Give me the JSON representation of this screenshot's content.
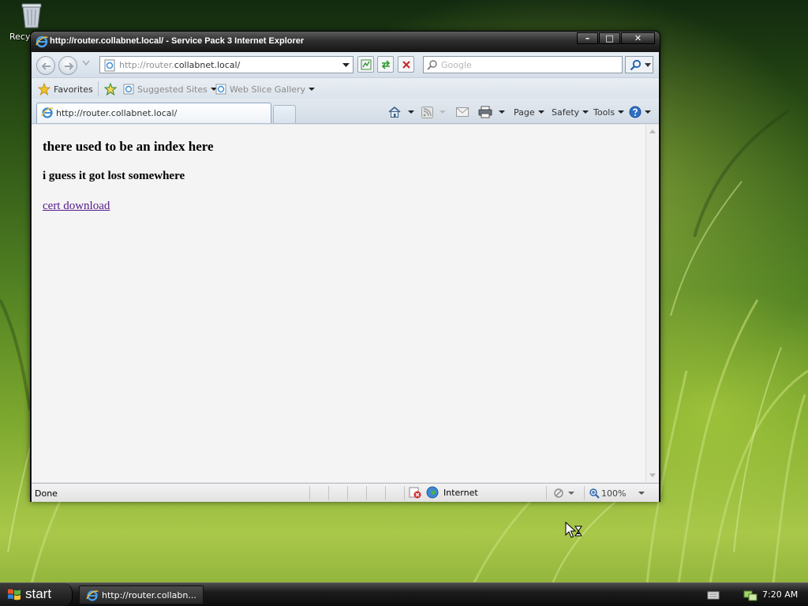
{
  "desktop": {
    "recycle_bin_label": "Recycle Bin"
  },
  "window": {
    "title": "http://router.collabnet.local/ - Service Pack 3 Internet Explorer",
    "controls": {
      "minimize": "–",
      "maximize": "□",
      "close": "✕"
    }
  },
  "address_bar": {
    "url_prefix": "http://router.",
    "url_domain": "collabnet.local/",
    "search_placeholder": "Google"
  },
  "favorites_bar": {
    "favorites_label": "Favorites",
    "suggested_sites_label": "Suggested Sites",
    "web_slice_gallery_label": "Web Slice Gallery"
  },
  "tabs": [
    {
      "label": "http://router.collabnet.local/"
    }
  ],
  "command_bar": {
    "page_label": "Page",
    "safety_label": "Safety",
    "tools_label": "Tools"
  },
  "page": {
    "heading": "there used to be an index here",
    "subheading": "i guess it got lost somewhere",
    "link_text": "cert download"
  },
  "status_bar": {
    "status_text": "Done",
    "zone_text": "Internet",
    "zoom_text": "100%"
  },
  "taskbar": {
    "start_label": "start",
    "task_button_label": "http://router.collabn...",
    "clock": "7:20 AM"
  },
  "colors": {
    "link_visited": "#551a8b",
    "content_bg": "#f4f4f4",
    "titlebar": "#2e2e2e"
  }
}
